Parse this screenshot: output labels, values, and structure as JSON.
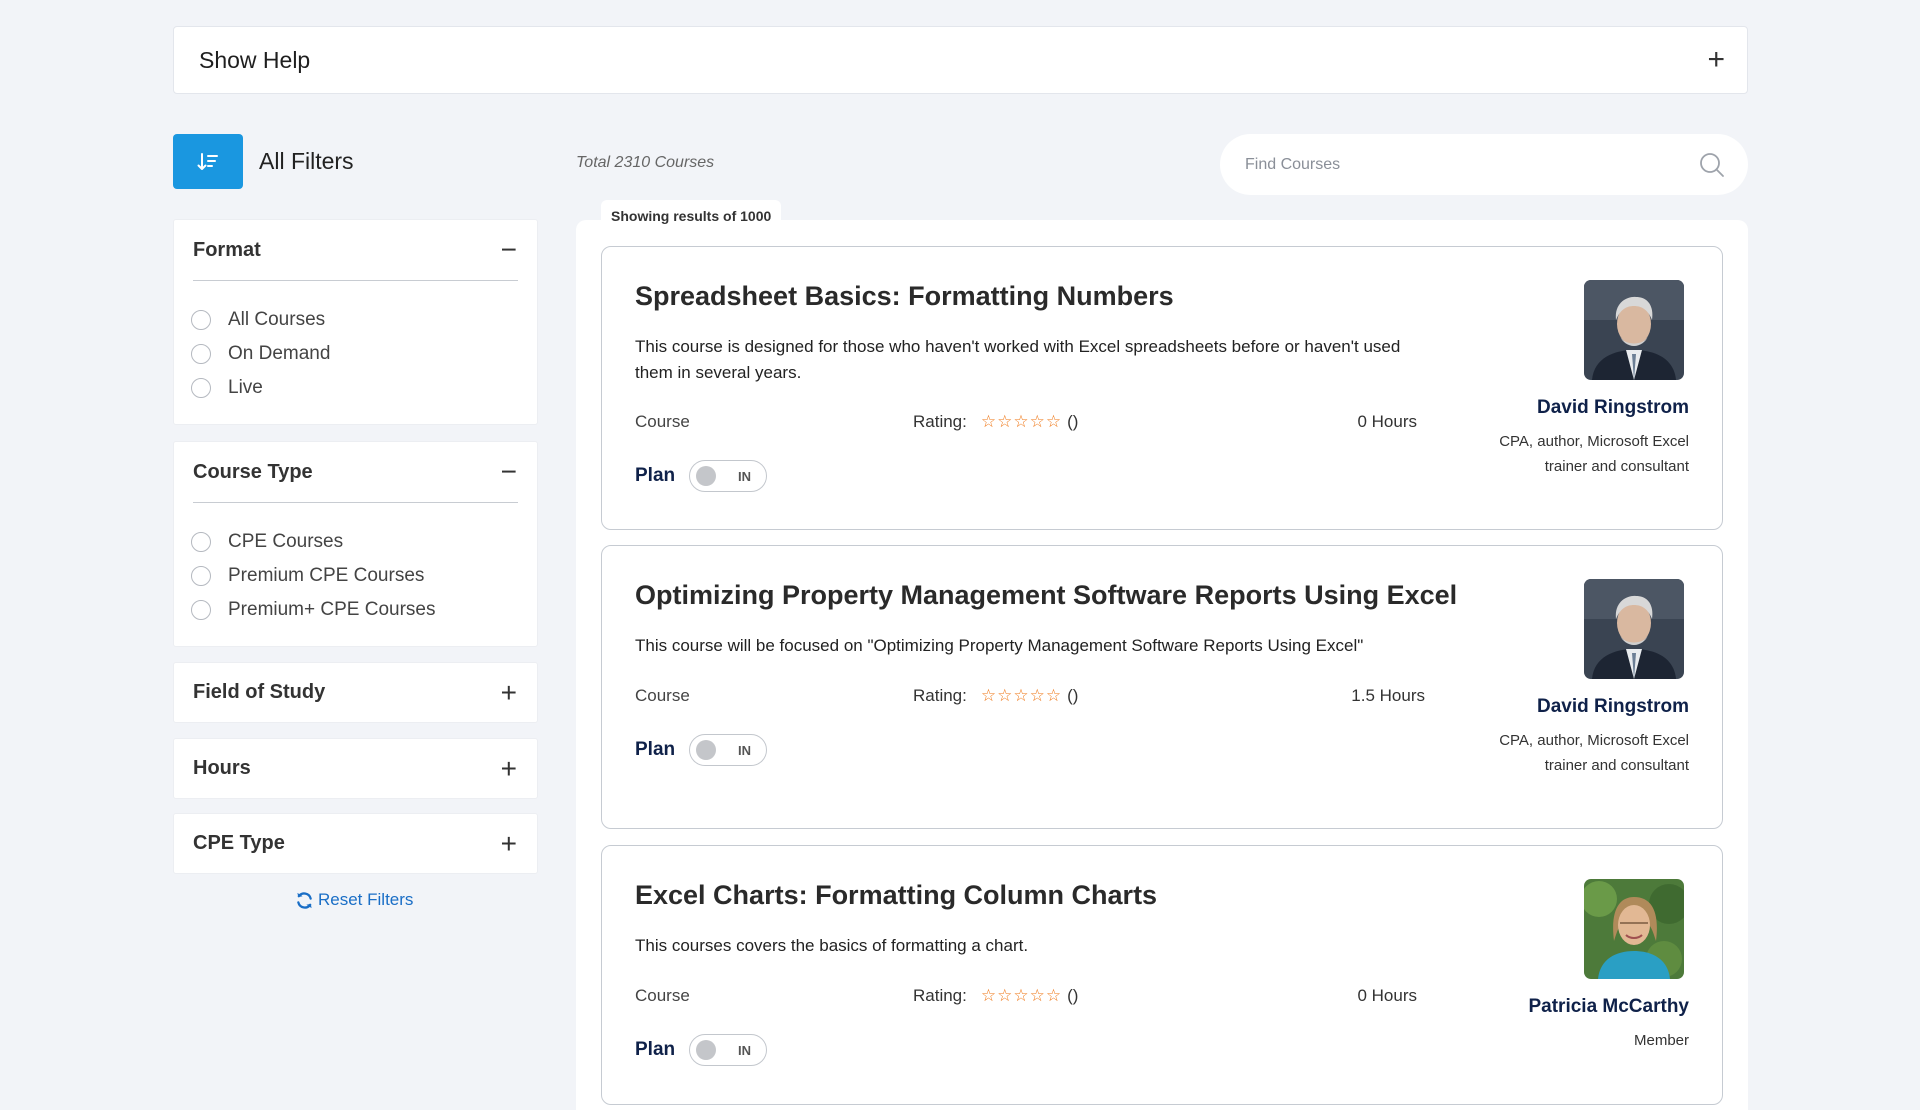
{
  "help": {
    "title": "Show Help",
    "toggle": "+"
  },
  "filters": {
    "button_icon": "sort-icon",
    "label": "All Filters",
    "reset_label": "Reset Filters",
    "panels": [
      {
        "title": "Format",
        "toggle": "−",
        "expanded": true,
        "options": [
          "All Courses",
          "On Demand",
          "Live"
        ]
      },
      {
        "title": "Course Type",
        "toggle": "−",
        "expanded": true,
        "options": [
          "CPE Courses",
          "Premium CPE Courses",
          "Premium+ CPE Courses"
        ]
      },
      {
        "title": "Field of Study",
        "toggle": "+",
        "expanded": false
      },
      {
        "title": "Hours",
        "toggle": "+",
        "expanded": false
      },
      {
        "title": "CPE Type",
        "toggle": "+",
        "expanded": false
      }
    ]
  },
  "results": {
    "total": "Total 2310 Courses",
    "showing": "Showing results of 1000",
    "search_placeholder": "Find Courses"
  },
  "courses": [
    {
      "title": "Spreadsheet Basics: Formatting Numbers",
      "description": "This course is designed for those who haven't worked with Excel spreadsheets before or haven't used them in several years.",
      "type": "Course",
      "rating_label": "Rating:",
      "stars": "☆☆☆☆☆",
      "rating_count": "()",
      "hours": "0 Hours",
      "plan_label": "Plan",
      "plan_toggle": "IN",
      "author": "David Ringstrom",
      "author_role": "CPA, author, Microsoft Excel trainer and consultant",
      "avatar": "man-portrait"
    },
    {
      "title": "Optimizing Property Management Software Reports Using Excel",
      "description": "This course will be focused on \"Optimizing Property Management Software Reports Using Excel\"",
      "type": "Course",
      "rating_label": "Rating:",
      "stars": "☆☆☆☆☆",
      "rating_count": "()",
      "hours": "1.5 Hours",
      "plan_label": "Plan",
      "plan_toggle": "IN",
      "author": "David Ringstrom",
      "author_role": "CPA, author, Microsoft Excel trainer and consultant",
      "avatar": "man-portrait"
    },
    {
      "title": "Excel Charts: Formatting Column Charts",
      "description": "This courses covers the basics of formatting a chart.",
      "type": "Course",
      "rating_label": "Rating:",
      "stars": "☆☆☆☆☆",
      "rating_count": "()",
      "hours": "0 Hours",
      "plan_label": "Plan",
      "plan_toggle": "IN",
      "author": "Patricia McCarthy",
      "author_role": "Member",
      "avatar": "woman-portrait"
    }
  ],
  "colors": {
    "accent": "#1a97e0",
    "star": "#f07b1d",
    "navy": "#0f2149",
    "link": "#1a6ec6"
  }
}
